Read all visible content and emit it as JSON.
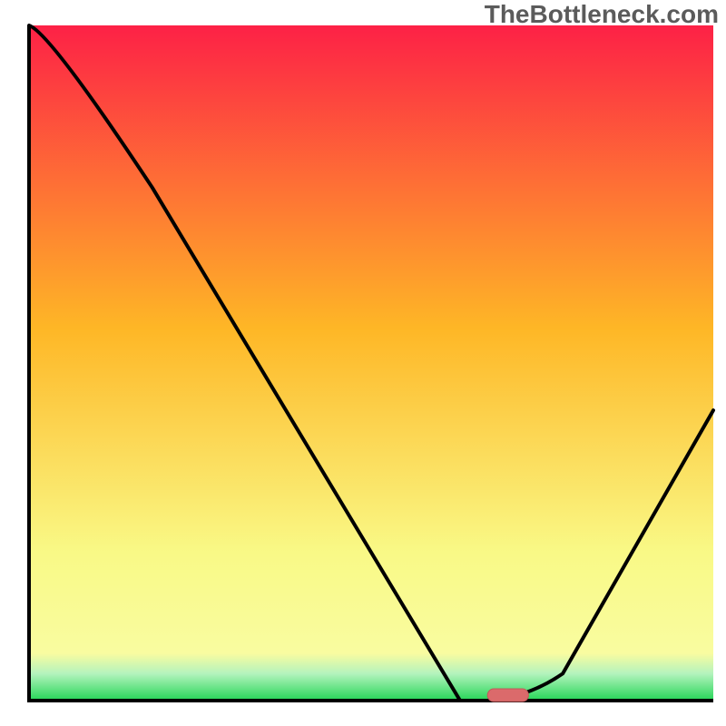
{
  "watermark": "TheBottleneck.com",
  "colors": {
    "axis": "#000000",
    "curve": "#000000",
    "marker_fill": "#db6a6b",
    "marker_stroke": "#c25a5b",
    "gradient_top": "#fd2146",
    "gradient_mid_upper": "#feb726",
    "gradient_mid_lower": "#f9f986",
    "gradient_green_light": "#b4f3bd",
    "gradient_green": "#25d657",
    "frame_bg": "#ffffff"
  },
  "chart_data": {
    "type": "line",
    "title": "",
    "xlabel": "",
    "ylabel": "",
    "xlim": [
      0,
      100
    ],
    "ylim": [
      0,
      100
    ],
    "x": [
      0,
      3,
      18,
      63,
      67,
      73,
      78,
      100
    ],
    "values": [
      100,
      99,
      76,
      0,
      0,
      0.5,
      4,
      43
    ],
    "marker": {
      "x_start": 67,
      "x_end": 73,
      "y": 0.8
    },
    "notes": "V-shaped bottleneck curve; minimum (optimal) region ~67–73 on x-axis. Color gradient background runs vertically (red top → green bottom), representing bottleneck severity."
  }
}
